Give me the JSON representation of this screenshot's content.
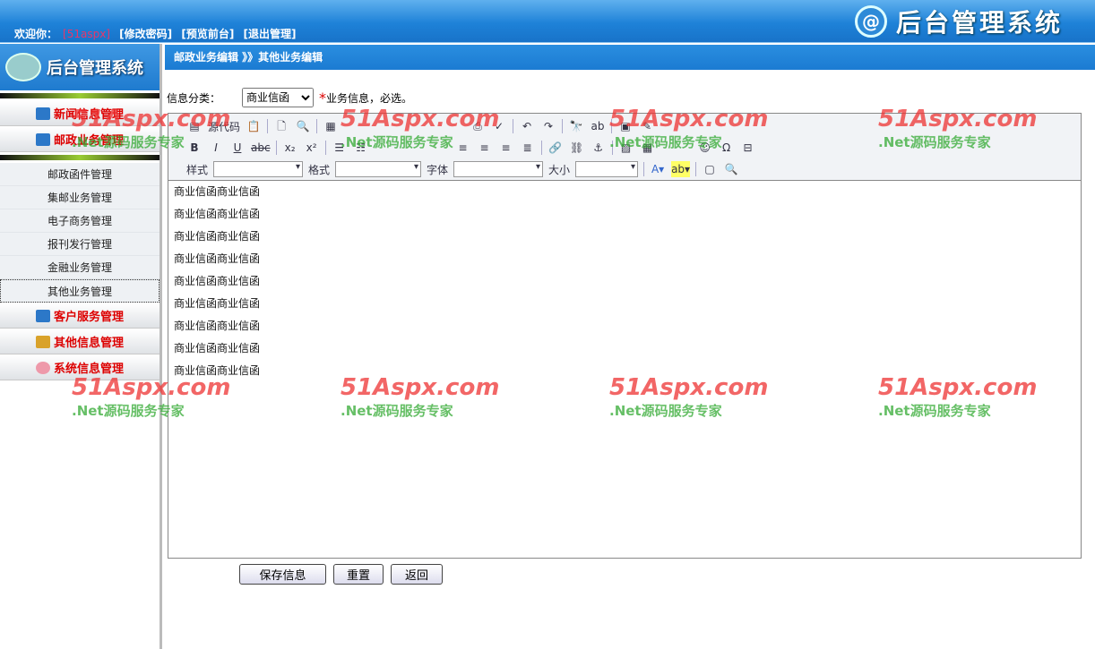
{
  "header": {
    "welcome": "欢迎你：",
    "user": "[51aspx]",
    "links": [
      "[修改密码]",
      "[预览前台]",
      "[退出管理]"
    ],
    "brand": "后台管理系统"
  },
  "sidebar": {
    "logo": "后台管理系统",
    "cats": [
      "新闻信息管理",
      "邮政业务管理"
    ],
    "subs": [
      "邮政函件管理",
      "集邮业务管理",
      "电子商务管理",
      "报刊发行管理",
      "金融业务管理",
      "其他业务管理"
    ],
    "cats2": [
      "客户服务管理",
      "其他信息管理",
      "系统信息管理"
    ]
  },
  "breadcrumb": "邮政业务编辑 》》其他业务编辑",
  "form": {
    "label": "信息分类：",
    "selected": "商业信函",
    "hint": "业务信息，必选。",
    "star": "*"
  },
  "editor": {
    "source": "源代码",
    "style": "样式",
    "format": "格式",
    "font": "字体",
    "size": "大小",
    "lines": [
      "商业信函商业信函",
      "商业信函商业信函",
      "商业信函商业信函",
      "商业信函商业信函",
      "商业信函商业信函",
      "商业信函商业信函",
      "商业信函商业信函",
      "商业信函商业信函",
      "商业信函商业信函"
    ]
  },
  "buttons": {
    "save": "保存信息",
    "reset": "重置",
    "back": "返回"
  },
  "watermark": {
    "logo": "51Aspx.com",
    "slogan": ".Net源码服务专家"
  }
}
